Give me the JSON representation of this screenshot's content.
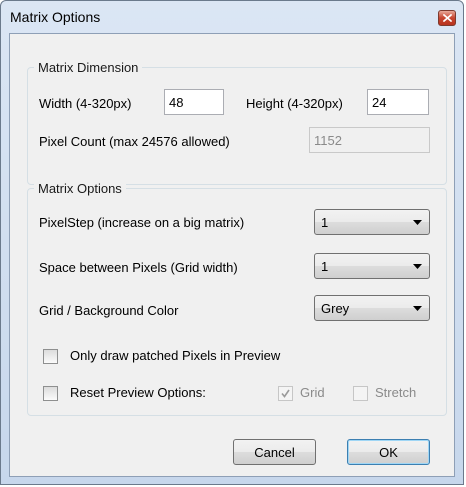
{
  "window": {
    "title": "Matrix Options"
  },
  "dimension": {
    "legend": "Matrix Dimension",
    "width_label": "Width (4-320px)",
    "width_value": "48",
    "height_label": "Height (4-320px)",
    "height_value": "24",
    "pixel_count_label": "Pixel Count (max 24576 allowed)",
    "pixel_count_value": "1152"
  },
  "options": {
    "legend": "Matrix Options",
    "pixelstep_label": "PixelStep (increase on a big matrix)",
    "pixelstep_value": "1",
    "space_label": "Space between Pixels (Grid width)",
    "space_value": "1",
    "color_label": "Grid / Background Color",
    "color_value": "Grey",
    "only_patched_label": "Only draw patched Pixels in Preview",
    "only_patched_checked": false,
    "reset_label": "Reset Preview Options:",
    "reset_checked": false,
    "grid_label": "Grid",
    "grid_checked": true,
    "stretch_label": "Stretch",
    "stretch_checked": false
  },
  "buttons": {
    "cancel": "Cancel",
    "ok": "OK"
  }
}
